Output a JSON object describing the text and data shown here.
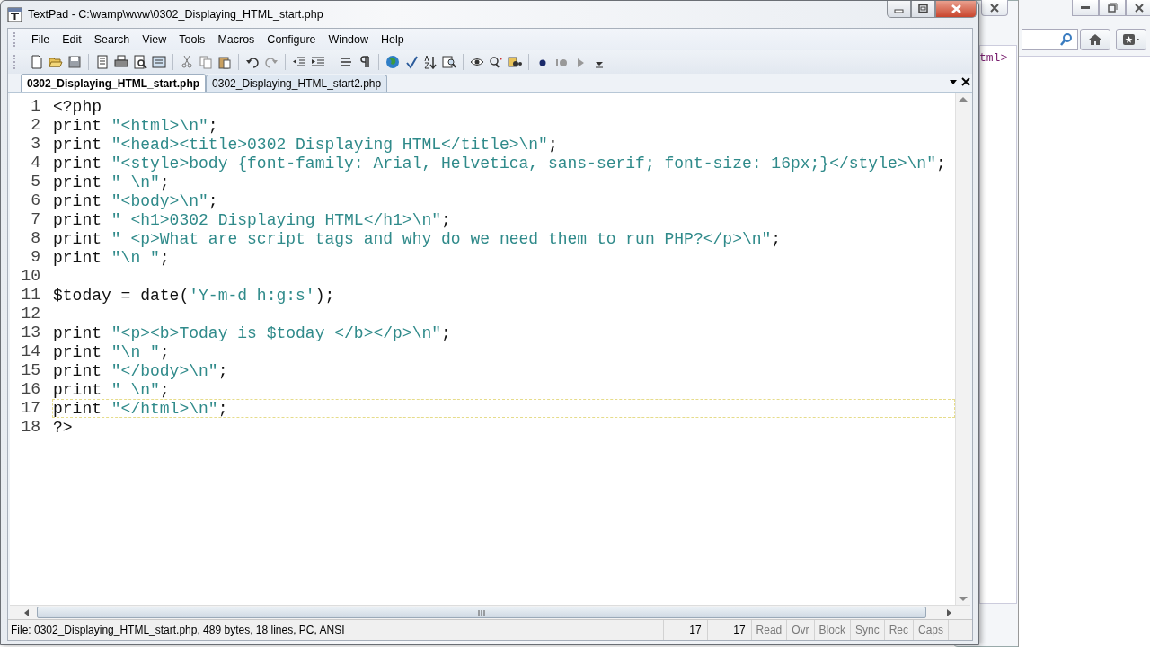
{
  "window": {
    "title": "TextPad - C:\\wamp\\www\\0302_Displaying_HTML_start.php"
  },
  "menu": [
    "File",
    "Edit",
    "Search",
    "View",
    "Tools",
    "Macros",
    "Configure",
    "Window",
    "Help"
  ],
  "tabs": [
    {
      "label": "0302_Displaying_HTML_start.php",
      "selected": true
    },
    {
      "label": "0302_Displaying_HTML_start2.php",
      "selected": false
    }
  ],
  "editor": {
    "lines": [
      {
        "number": "1",
        "current": false,
        "segments": [
          {
            "kind": "plain",
            "text": "<?php"
          }
        ]
      },
      {
        "number": "2",
        "current": false,
        "segments": [
          {
            "kind": "plain",
            "text": "print "
          },
          {
            "kind": "string",
            "text": "\"<html>\\n\""
          },
          {
            "kind": "plain",
            "text": ";"
          }
        ]
      },
      {
        "number": "3",
        "current": false,
        "segments": [
          {
            "kind": "plain",
            "text": "print "
          },
          {
            "kind": "string",
            "text": "\"<head><title>0302 Displaying HTML</title>\\n\""
          },
          {
            "kind": "plain",
            "text": ";"
          }
        ]
      },
      {
        "number": "4",
        "current": false,
        "segments": [
          {
            "kind": "plain",
            "text": "print "
          },
          {
            "kind": "string",
            "text": "\"<style>body {font-family: Arial, Helvetica, sans-serif; font-size: 16px;}</style>\\n\""
          },
          {
            "kind": "plain",
            "text": ";"
          }
        ]
      },
      {
        "number": "5",
        "current": false,
        "segments": [
          {
            "kind": "plain",
            "text": "print "
          },
          {
            "kind": "string",
            "text": "\" \\n\""
          },
          {
            "kind": "plain",
            "text": ";"
          }
        ]
      },
      {
        "number": "6",
        "current": false,
        "segments": [
          {
            "kind": "plain",
            "text": "print "
          },
          {
            "kind": "string",
            "text": "\"<body>\\n\""
          },
          {
            "kind": "plain",
            "text": ";"
          }
        ]
      },
      {
        "number": "7",
        "current": false,
        "segments": [
          {
            "kind": "plain",
            "text": "print "
          },
          {
            "kind": "string",
            "text": "\" <h1>0302 Displaying HTML</h1>\\n\""
          },
          {
            "kind": "plain",
            "text": ";"
          }
        ]
      },
      {
        "number": "8",
        "current": false,
        "segments": [
          {
            "kind": "plain",
            "text": "print "
          },
          {
            "kind": "string",
            "text": "\" <p>What are script tags and why do we need them to run PHP?</p>\\n\""
          },
          {
            "kind": "plain",
            "text": ";"
          }
        ]
      },
      {
        "number": "9",
        "current": false,
        "segments": [
          {
            "kind": "plain",
            "text": "print "
          },
          {
            "kind": "string",
            "text": "\"\\n \""
          },
          {
            "kind": "plain",
            "text": ";"
          }
        ]
      },
      {
        "number": "10",
        "current": false
      },
      {
        "number": "11",
        "current": false,
        "segments": [
          {
            "kind": "plain",
            "text": "$today = date("
          },
          {
            "kind": "string",
            "text": "'Y-m-d h:g:s'"
          },
          {
            "kind": "plain",
            "text": ");"
          }
        ]
      },
      {
        "number": "12",
        "current": false
      },
      {
        "number": "13",
        "current": false,
        "segments": [
          {
            "kind": "plain",
            "text": "print "
          },
          {
            "kind": "string",
            "text": "\"<p><b>Today is $today </b></p>\\n\""
          },
          {
            "kind": "plain",
            "text": ";"
          }
        ]
      },
      {
        "number": "14",
        "current": false,
        "segments": [
          {
            "kind": "plain",
            "text": "print "
          },
          {
            "kind": "string",
            "text": "\"\\n \""
          },
          {
            "kind": "plain",
            "text": ";"
          }
        ]
      },
      {
        "number": "15",
        "current": false,
        "segments": [
          {
            "kind": "plain",
            "text": "print "
          },
          {
            "kind": "string",
            "text": "\"</body>\\n\""
          },
          {
            "kind": "plain",
            "text": ";"
          }
        ]
      },
      {
        "number": "16",
        "current": false,
        "segments": [
          {
            "kind": "plain",
            "text": "print "
          },
          {
            "kind": "string",
            "text": "\" \\n\""
          },
          {
            "kind": "plain",
            "text": ";"
          }
        ]
      },
      {
        "number": "17",
        "current": true,
        "segments": [
          {
            "kind": "plain",
            "text": "print "
          },
          {
            "kind": "string",
            "text": "\"</html>\\n\""
          },
          {
            "kind": "plain",
            "text": ";"
          }
        ]
      },
      {
        "number": "18",
        "current": false,
        "segments": [
          {
            "kind": "plain",
            "text": "?>"
          }
        ]
      }
    ]
  },
  "status_bar": {
    "file_info": "File: 0302_Displaying_HTML_start.php, 489 bytes, 18 lines, PC, ANSI",
    "line": "17",
    "column": "17",
    "indicators": [
      {
        "label": "Read",
        "on": false
      },
      {
        "label": "Ovr",
        "on": false
      },
      {
        "label": "Block",
        "on": false
      },
      {
        "label": "Sync",
        "on": false
      },
      {
        "label": "Rec",
        "on": false
      },
      {
        "label": "Caps",
        "on": false
      }
    ]
  },
  "background_window": {
    "code_fragment": "tml>"
  }
}
